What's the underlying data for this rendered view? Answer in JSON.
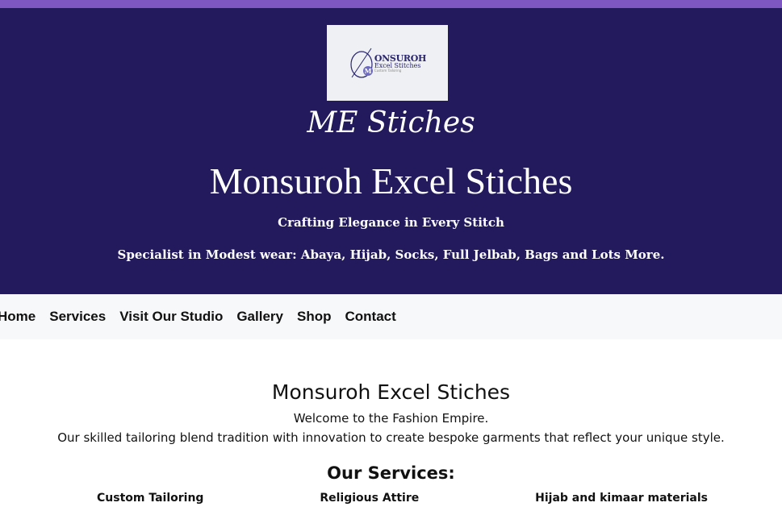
{
  "hero": {
    "logo": {
      "name": "ONSUROH",
      "subtitle": "Excel Stitches",
      "tagline_small": "Custom Tailoring",
      "monogram": "M"
    },
    "script_title": "ME Stiches",
    "title": "Monsuroh Excel Stiches",
    "tagline": "Crafting Elegance in Every Stitch",
    "specialist": "Specialist in Modest wear: Abaya, Hijab, Socks, Full Jelbab, Bags and Lots More."
  },
  "nav": {
    "items": [
      {
        "label": "Home"
      },
      {
        "label": "Services"
      },
      {
        "label": "Visit Our Studio"
      },
      {
        "label": "Gallery"
      },
      {
        "label": "Shop"
      },
      {
        "label": "Contact"
      }
    ]
  },
  "main": {
    "title": "Monsuroh Excel Stiches",
    "welcome": "Welcome to the Fashion Empire.",
    "description": "Our skilled tailoring blend tradition with innovation to create bespoke garments that reflect your unique style.",
    "services_title": "Our Services:",
    "services": [
      {
        "label": "Custom Tailoring"
      },
      {
        "label": "Religious Attire"
      },
      {
        "label": "Hijab and kimaar materials"
      }
    ]
  },
  "colors": {
    "accent_strip": "#7e57c2",
    "hero_bg": "#221a5c",
    "nav_bg": "#f7f8f9"
  }
}
